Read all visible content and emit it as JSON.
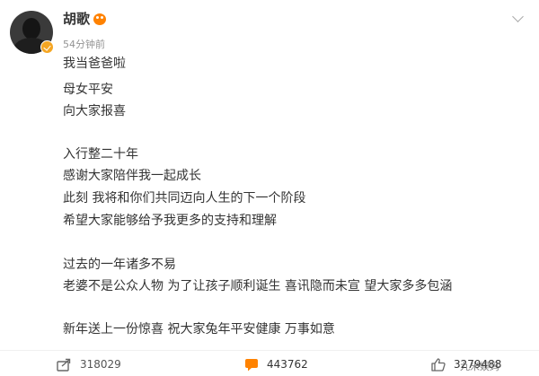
{
  "post": {
    "author": "胡歌",
    "time": "54分钟前",
    "lines": [
      "我当爸爸啦",
      "母女平安",
      "向大家报喜",
      "入行整二十年",
      "感谢大家陪伴我一起成长",
      "此刻 我将和你们共同迈向人生的下一个阶段",
      "希望大家能够给予我更多的支持和理解",
      "过去的一年诸多不易",
      "老婆不是公众人物 为了让孩子顺利诞生 喜讯隐而未宣 望大家多多包涵",
      "新年送上一份惊喜 祝大家兔年平安健康 万事如意"
    ]
  },
  "actions": {
    "share_count": "318029",
    "comment_count": "443762",
    "like_count": "3279488"
  },
  "watermark": "九米娱妈",
  "icons": {
    "share": "share-icon",
    "comment": "comment-icon",
    "like": "like-icon",
    "more": "chevron-down-icon",
    "verified": "verified-badge-icon"
  },
  "colors": {
    "comment_icon": "#ff8200",
    "verified_badge": "#f5a623",
    "text": "#333333",
    "meta": "#939393"
  }
}
